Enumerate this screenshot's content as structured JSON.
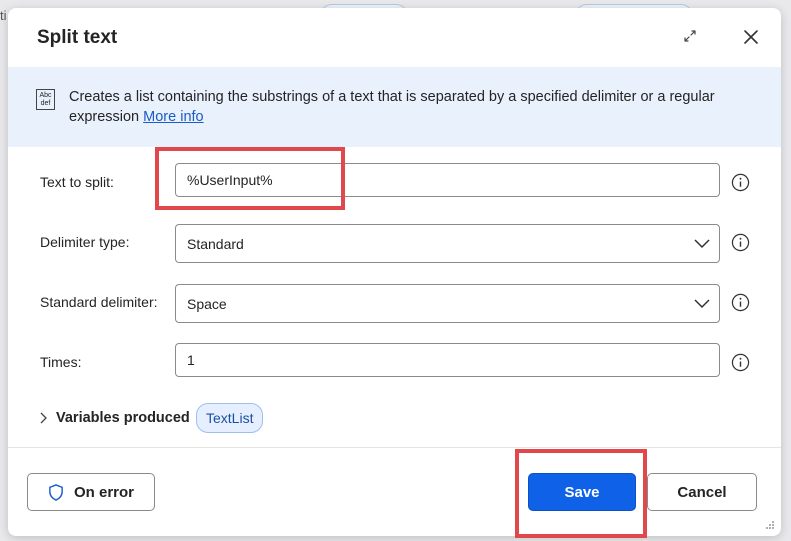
{
  "dialog": {
    "title": "Split text",
    "info_text": "Creates a list containing the substrings of a text that is separated by a specified delimiter or a regular expression",
    "more_info_label": "More info",
    "info_icon_text": "Abc def"
  },
  "fields": {
    "text_to_split": {
      "label": "Text to split:",
      "value": "%UserInput%"
    },
    "delimiter_type": {
      "label": "Delimiter type:",
      "value": "Standard"
    },
    "standard_delimiter": {
      "label": "Standard delimiter:",
      "value": "Space"
    },
    "times": {
      "label": "Times:",
      "value": "1"
    }
  },
  "variables": {
    "label": "Variables produced",
    "items": [
      "TextList"
    ]
  },
  "footer": {
    "on_error_label": "On error",
    "save_label": "Save",
    "cancel_label": "Cancel"
  },
  "backdrop": {
    "partial_text": "ti"
  },
  "colors": {
    "primary": "#0f62e8",
    "highlight": "#e0484b",
    "banner": "#e8f1fc",
    "link": "#1a5cc8"
  },
  "icons": [
    "expand-icon",
    "close-icon",
    "text-abc-icon",
    "info-circle-icon",
    "chevron-down-icon",
    "chevron-right-icon",
    "shield-icon",
    "resize-grip-icon"
  ]
}
